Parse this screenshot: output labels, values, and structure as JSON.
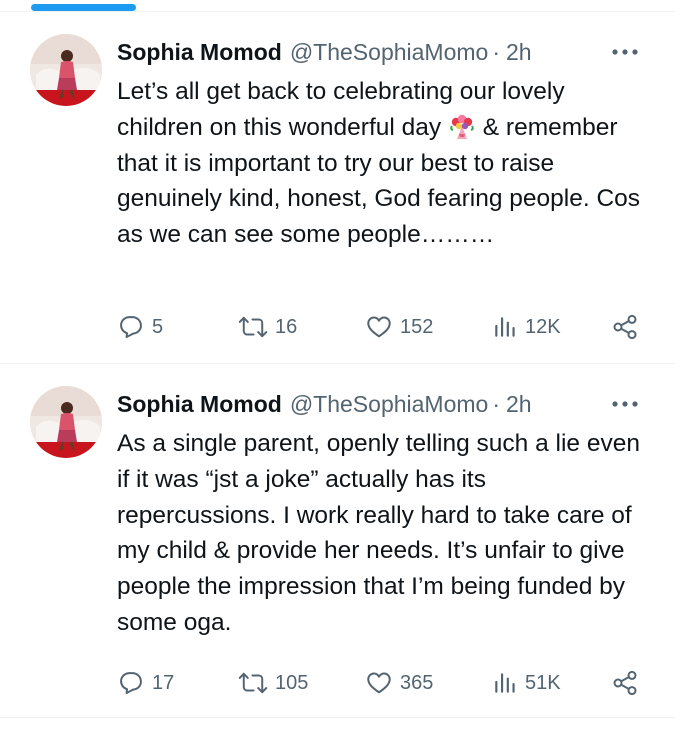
{
  "colors": {
    "accent": "#1d9bf0",
    "text_primary": "#0f1419",
    "text_secondary": "#536471",
    "divider": "#eff3f4"
  },
  "icons": {
    "reply": "reply-icon",
    "retweet": "retweet-icon",
    "like": "heart-icon",
    "views": "views-icon",
    "share": "share-icon",
    "more": "more-icon",
    "emoji": "bouquet-emoji-icon"
  },
  "tweets": [
    {
      "author_name": "Sophia Momod",
      "handle": "@TheSophiaMomo",
      "separator": "·",
      "time": "2h",
      "text_before_emoji": "Let’s all get back to celebrating our lovely children on this wonderful day ",
      "text_after_emoji": " & remember that it is important to try our best to raise genuinely kind, honest, God fearing people. Cos as we can see some people………",
      "replies": "5",
      "retweets": "16",
      "likes": "152",
      "views": "12K"
    },
    {
      "author_name": "Sophia Momod",
      "handle": "@TheSophiaMomo",
      "separator": "·",
      "time": "2h",
      "text": "As a single parent, openly telling such a lie even if it was “jst a joke” actually has its repercussions. I work really hard to take care of my child & provide her needs. It’s unfair to give people the impression that I’m being funded by some oga.",
      "replies": "17",
      "retweets": "105",
      "likes": "365",
      "views": "51K"
    }
  ]
}
